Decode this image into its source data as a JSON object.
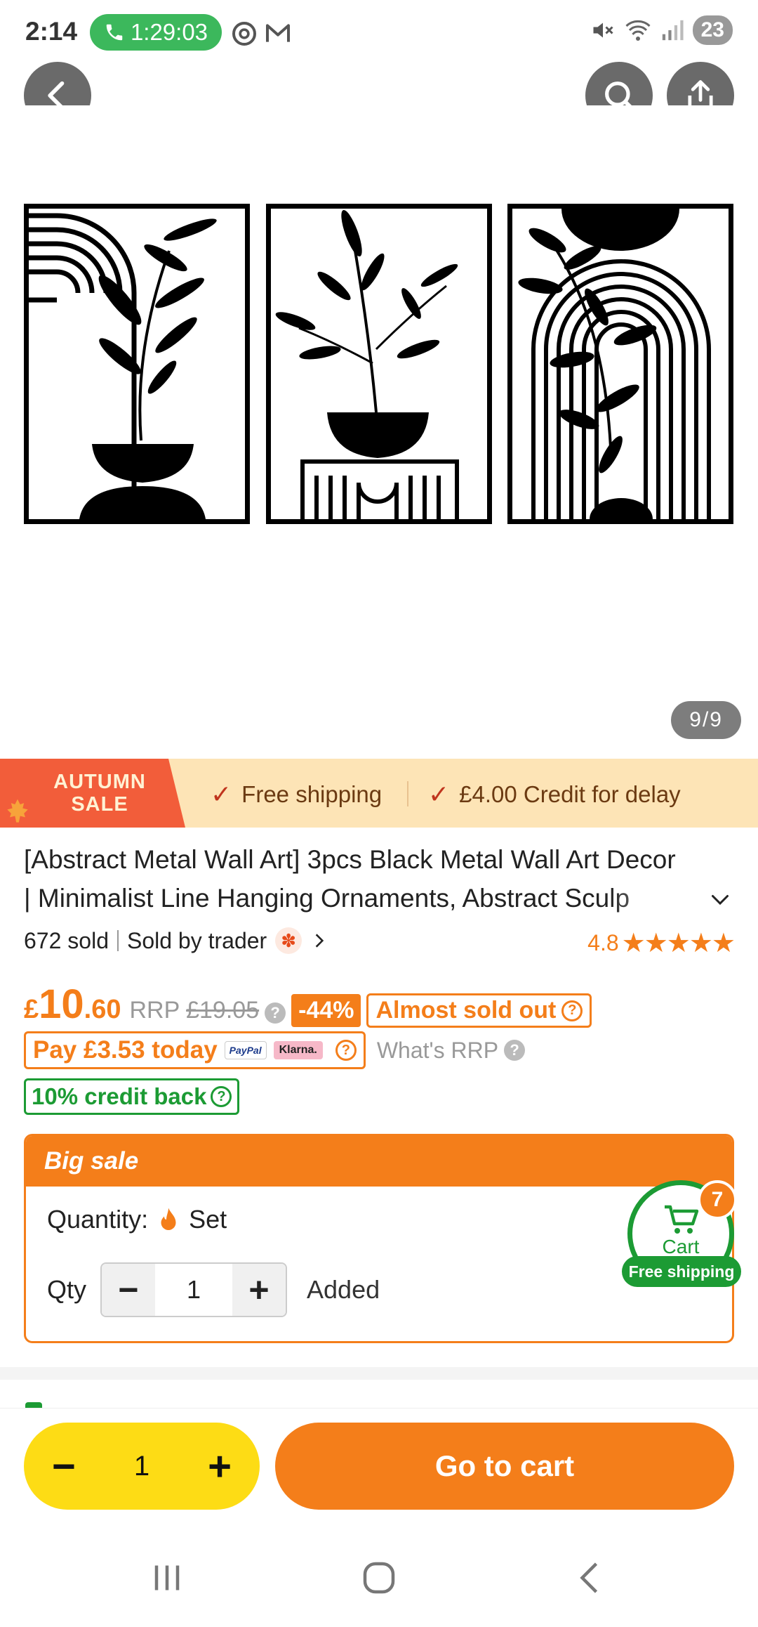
{
  "status_bar": {
    "time": "2:14",
    "call_timer": "1:29:03",
    "battery": "23"
  },
  "gallery": {
    "counter": "9/9"
  },
  "promo": {
    "badge_line1": "AUTUMN",
    "badge_line2": "SALE",
    "free_shipping": "Free shipping",
    "credit_delay": "£4.00 Credit for delay"
  },
  "product": {
    "title_line1": "[Abstract Metal Wall Art] 3pcs Black Metal Wall Art Decor",
    "title_line2": "| Minimalist Line Hanging Ornaments, Abstract Sculp",
    "sold": "672 sold",
    "sold_by": "Sold by trader",
    "rating": "4.8",
    "stars": "★★★★★"
  },
  "pricing": {
    "currency": "£",
    "price_whole": "10",
    "price_decimal": ".60",
    "rrp_label": "RRP",
    "rrp_value": "£19.05",
    "discount": "-44%",
    "almost_sold_out": "Almost sold out",
    "pay_today": "Pay £3.53 today",
    "paypal": "PayPal",
    "klarna": "Klarna.",
    "whats_rrp": "What's RRP",
    "credit_back": "10% credit back",
    "help_glyph": "?"
  },
  "sale_box": {
    "header": "Big sale",
    "quantity_label": "Quantity:",
    "quantity_value": "Set",
    "qty_label": "Qty",
    "qty_value": "1",
    "minus": "−",
    "plus": "+",
    "added": "Added"
  },
  "cart_float": {
    "label": "Cart",
    "count": "7",
    "free_shipping": "Free shipping"
  },
  "bottom_bar": {
    "qty_value": "1",
    "minus": "−",
    "plus": "+",
    "go_to_cart": "Go to cart"
  },
  "colors": {
    "accent_orange": "#f47e1a",
    "green": "#1c9b34",
    "yellow": "#fddc15",
    "promo_bg": "#fde4b6",
    "autumn_red": "#f25d3a"
  }
}
